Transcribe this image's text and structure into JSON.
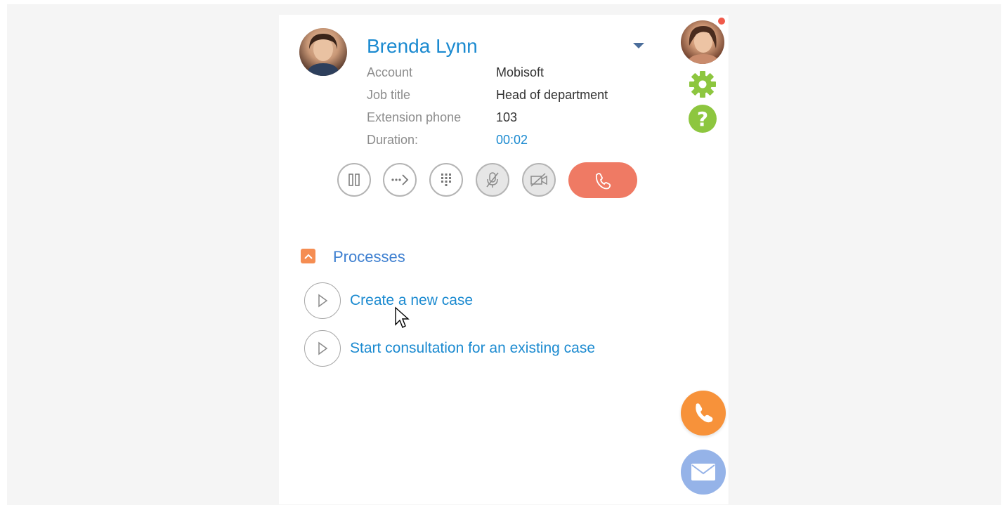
{
  "contact": {
    "name": "Brenda Lynn",
    "fields": [
      {
        "label": "Account",
        "value": "Mobisoft"
      },
      {
        "label": "Job title",
        "value": "Head of department"
      },
      {
        "label": "Extension phone",
        "value": "103"
      },
      {
        "label": "Duration:",
        "value": "00:02"
      }
    ]
  },
  "controls": [
    "pause-icon",
    "transfer-icon",
    "keypad-icon",
    "mute-microphone-icon",
    "video-off-icon",
    "hang-up-icon"
  ],
  "processes": {
    "title": "Processes",
    "items": [
      {
        "label": "Create a new case"
      },
      {
        "label": "Start consultation for an existing case"
      }
    ]
  },
  "sidebar": {
    "icons": [
      "user-avatar",
      "gear-icon",
      "help-icon",
      "phone-icon",
      "mail-icon"
    ],
    "help_glyph": "?"
  },
  "colors": {
    "accent": "#1b8ad0",
    "hangup": "#ef7a64",
    "processes_toggle": "#f58d52",
    "settings": "#8dc63f",
    "call_fab": "#f7923a",
    "mail_fab": "#95b3e8"
  }
}
